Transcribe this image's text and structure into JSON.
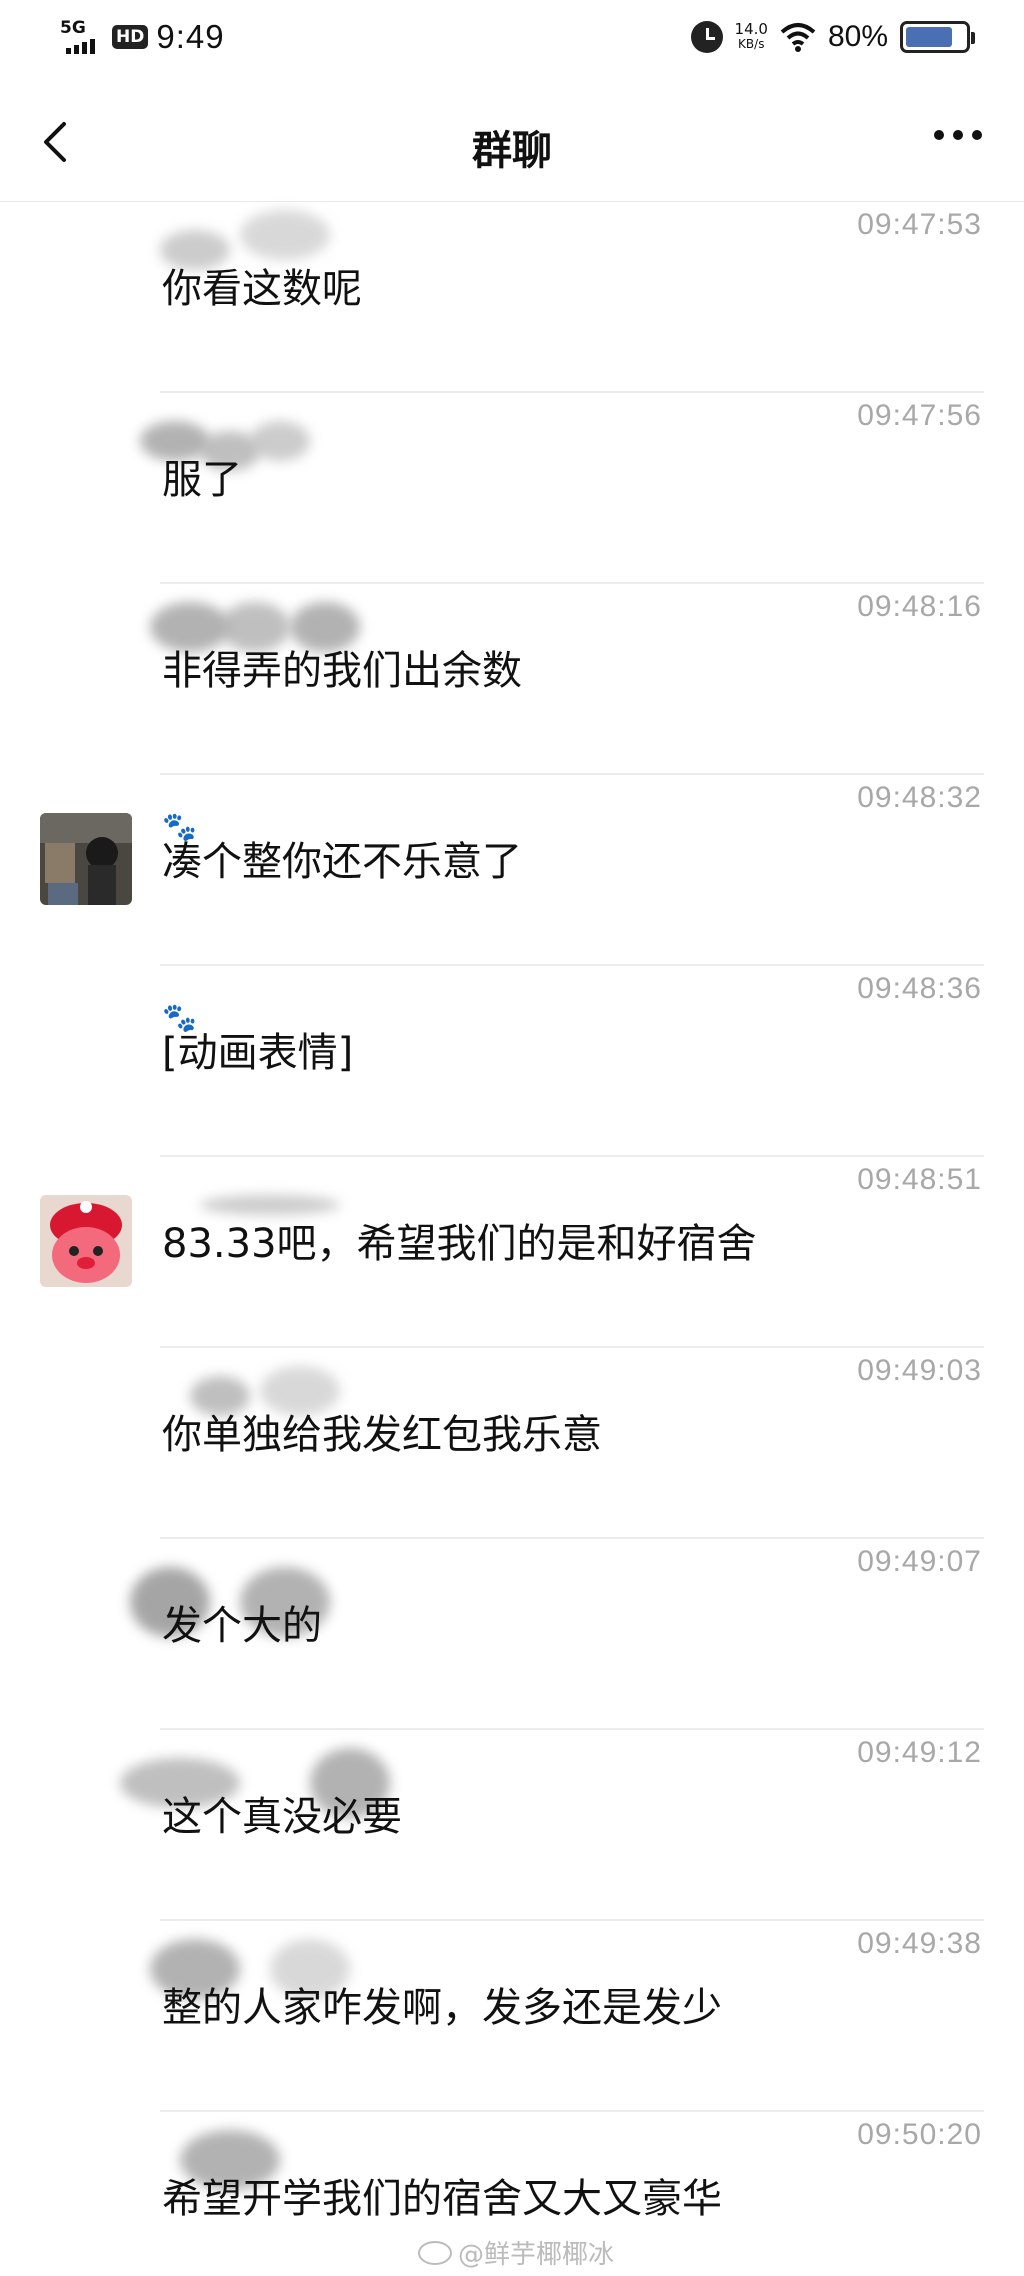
{
  "status_bar": {
    "network": "5G",
    "hd": "HD",
    "time": "9:49",
    "speed_value": "14.0",
    "speed_unit": "KB/s",
    "battery": "80%",
    "battery_level": 0.8
  },
  "nav": {
    "title": "群聊"
  },
  "messages": [
    {
      "time": "09:47:53",
      "text": "你看这数呢",
      "avatar": "none",
      "paw": ""
    },
    {
      "time": "09:47:56",
      "text": "服了",
      "avatar": "none",
      "paw": ""
    },
    {
      "time": "09:48:16",
      "text": "非得弄的我们出余数",
      "avatar": "none",
      "paw": ""
    },
    {
      "time": "09:48:32",
      "text": "凑个整你还不乐意了",
      "avatar": "photo",
      "paw": "🐾"
    },
    {
      "time": "09:48:36",
      "text": "[动画表情]",
      "avatar": "none",
      "paw": "🐾"
    },
    {
      "time": "09:48:51",
      "text": "83.33吧，希望我们的是和好宿舍",
      "avatar": "red-plush",
      "paw": ""
    },
    {
      "time": "09:49:03",
      "text": "你单独给我发红包我乐意",
      "avatar": "none",
      "paw": ""
    },
    {
      "time": "09:49:07",
      "text": "发个大的",
      "avatar": "none",
      "paw": ""
    },
    {
      "time": "09:49:12",
      "text": "这个真没必要",
      "avatar": "none",
      "paw": ""
    },
    {
      "time": "09:49:38",
      "text": "整的人家咋发啊，发多还是发少",
      "avatar": "none",
      "paw": ""
    },
    {
      "time": "09:50:20",
      "text": "希望开学我们的宿舍又大又豪华",
      "avatar": "none",
      "paw": ""
    }
  ],
  "watermark": "@鲜芋椰椰冰",
  "colors": {
    "timestamp": "#a8a8a8",
    "divider": "#ececec",
    "battery_fill": "#4a6fb3"
  }
}
